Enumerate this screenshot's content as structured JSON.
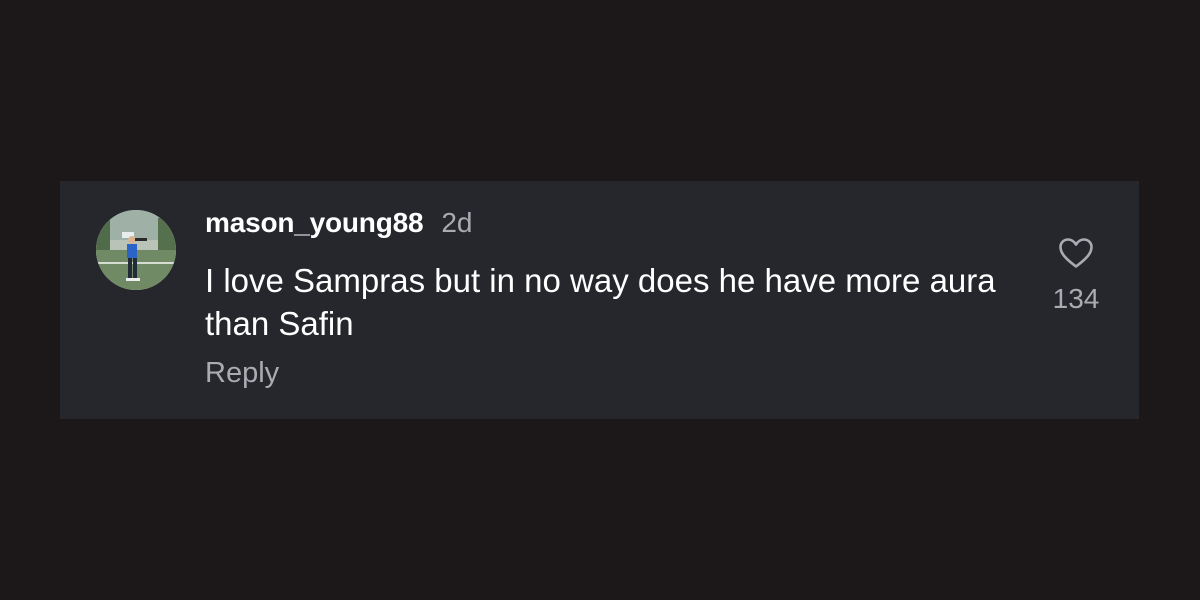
{
  "comment": {
    "username": "mason_young88",
    "time_ago": "2d",
    "text": "I love Sampras but in no way does he have more aura than Safin",
    "reply_label": "Reply",
    "like_count": "134",
    "avatar_icon": "user-avatar-photo",
    "like_icon": "heart-outline-icon"
  },
  "colors": {
    "page_background": "#1c1718",
    "card_background": "#25272d",
    "primary_text": "#ffffff",
    "secondary_text": "#a9abb1"
  }
}
